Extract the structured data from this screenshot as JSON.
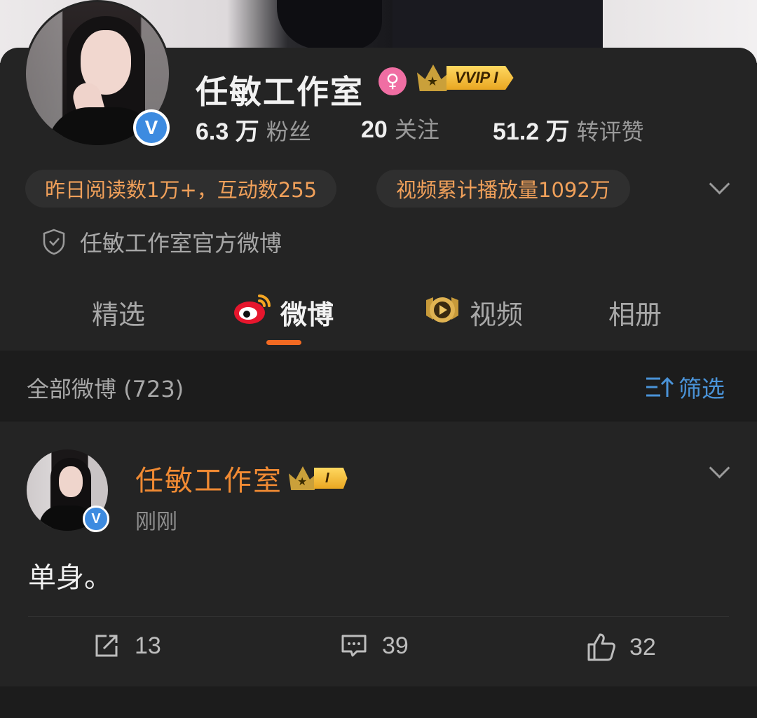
{
  "profile": {
    "name": "任敏工作室",
    "gender_symbol": "♀",
    "vip_label": "VVIP I",
    "verified_mark": "V",
    "stats": [
      {
        "value": "6.3 万",
        "label": "粉丝"
      },
      {
        "value": "20",
        "label": "关注"
      },
      {
        "value": "51.2 万",
        "label": "转评赞"
      }
    ],
    "pills": [
      "昨日阅读数1万+，互动数255",
      "视频累计播放量1092万"
    ],
    "official_desc": "任敏工作室官方微博"
  },
  "tabs": [
    "精选",
    "微博",
    "视频",
    "相册"
  ],
  "active_tab_index": 1,
  "filter_bar": {
    "all_label": "全部微博 (723)",
    "filter_label": "筛选"
  },
  "post": {
    "author": "任敏工作室",
    "vip_level": "I",
    "time": "刚刚",
    "body": "单身。",
    "actions": {
      "repost_count": "13",
      "comment_count": "39",
      "like_count": "32"
    }
  },
  "colors": {
    "accent_orange": "#f36a22",
    "link_blue": "#4a93d8",
    "pill_text": "#f0a05a",
    "verified_blue": "#3d8be0"
  }
}
